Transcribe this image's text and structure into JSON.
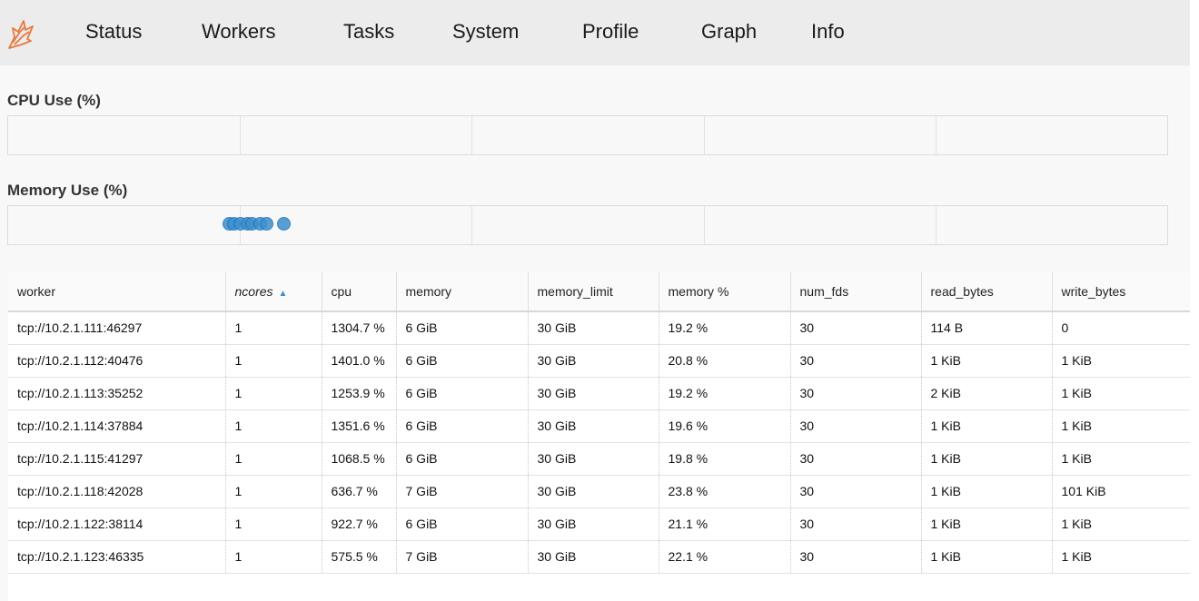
{
  "nav": {
    "logo_icon": "dask-logo-icon",
    "items": [
      "Status",
      "Workers",
      "Tasks",
      "System",
      "Profile",
      "Graph",
      "Info"
    ]
  },
  "cpu_section": {
    "title": "CPU Use (%)"
  },
  "memory_section": {
    "title": "Memory Use (%)"
  },
  "colors": {
    "accent": "#3b8fd0",
    "logo": "#e8773a"
  },
  "table": {
    "columns": [
      "worker",
      "ncores",
      "cpu",
      "memory",
      "memory_limit",
      "memory %",
      "num_fds",
      "read_bytes",
      "write_bytes"
    ],
    "sorted_column": "ncores",
    "sort_direction": "ascending",
    "rows": [
      [
        "tcp://10.2.1.111:46297",
        "1",
        "1304.7 %",
        "6 GiB",
        "30 GiB",
        "19.2 %",
        "30",
        "114 B",
        "0"
      ],
      [
        "tcp://10.2.1.112:40476",
        "1",
        "1401.0 %",
        "6 GiB",
        "30 GiB",
        "20.8 %",
        "30",
        "1 KiB",
        "1 KiB"
      ],
      [
        "tcp://10.2.1.113:35252",
        "1",
        "1253.9 %",
        "6 GiB",
        "30 GiB",
        "19.2 %",
        "30",
        "2 KiB",
        "1 KiB"
      ],
      [
        "tcp://10.2.1.114:37884",
        "1",
        "1351.6 %",
        "6 GiB",
        "30 GiB",
        "19.6 %",
        "30",
        "1 KiB",
        "1 KiB"
      ],
      [
        "tcp://10.2.1.115:41297",
        "1",
        "1068.5 %",
        "6 GiB",
        "30 GiB",
        "19.8 %",
        "30",
        "1 KiB",
        "1 KiB"
      ],
      [
        "tcp://10.2.1.118:42028",
        "1",
        "636.7 %",
        "7 GiB",
        "30 GiB",
        "23.8 %",
        "30",
        "1 KiB",
        "101 KiB"
      ],
      [
        "tcp://10.2.1.122:38114",
        "1",
        "922.7 %",
        "6 GiB",
        "30 GiB",
        "21.1 %",
        "30",
        "1 KiB",
        "1 KiB"
      ],
      [
        "tcp://10.2.1.123:46335",
        "1",
        "575.5 %",
        "7 GiB",
        "30 GiB",
        "22.1 %",
        "30",
        "1 KiB",
        "1 KiB"
      ]
    ]
  }
}
